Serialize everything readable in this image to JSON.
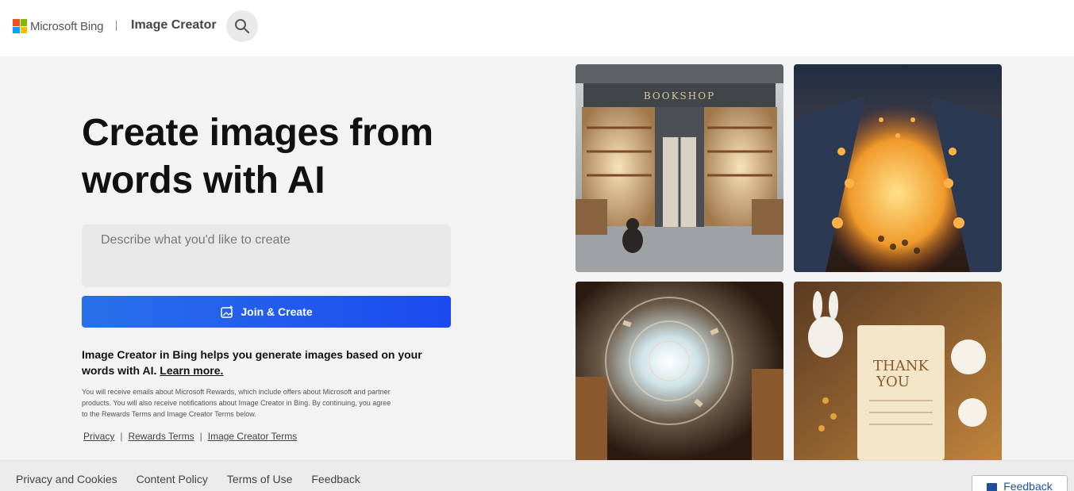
{
  "header": {
    "brand": "Microsoft Bing",
    "app_title": "Image Creator",
    "logo_colors": [
      "#f25022",
      "#7fba00",
      "#00a4ef",
      "#ffb900"
    ]
  },
  "hero": {
    "title": "Create images from words with AI",
    "prompt_placeholder": "Describe what you'd like to create",
    "join_label": "Join & Create",
    "description": "Image Creator in Bing helps you generate images based on your words with AI.",
    "learn_more": "Learn more.",
    "fine_print": "You will receive emails about Microsoft Rewards, which include offers about Microsoft and partner products. You will also receive notifications about Image Creator in Bing. By continuing, you agree to the Rewards Terms and Image Creator Terms below.",
    "links": [
      "Privacy",
      "Rewards Terms",
      "Image Creator Terms"
    ]
  },
  "gallery": {
    "bookshop_sign": "BOOKSHOP",
    "card_text_1": "THANK",
    "card_text_2": "YOU"
  },
  "footer": {
    "links": [
      "Privacy and Cookies",
      "Content Policy",
      "Terms of Use",
      "Feedback"
    ],
    "feedback_button": "Feedback"
  },
  "colors": {
    "accent_start": "#2870ea",
    "accent_end": "#1b4aef"
  }
}
